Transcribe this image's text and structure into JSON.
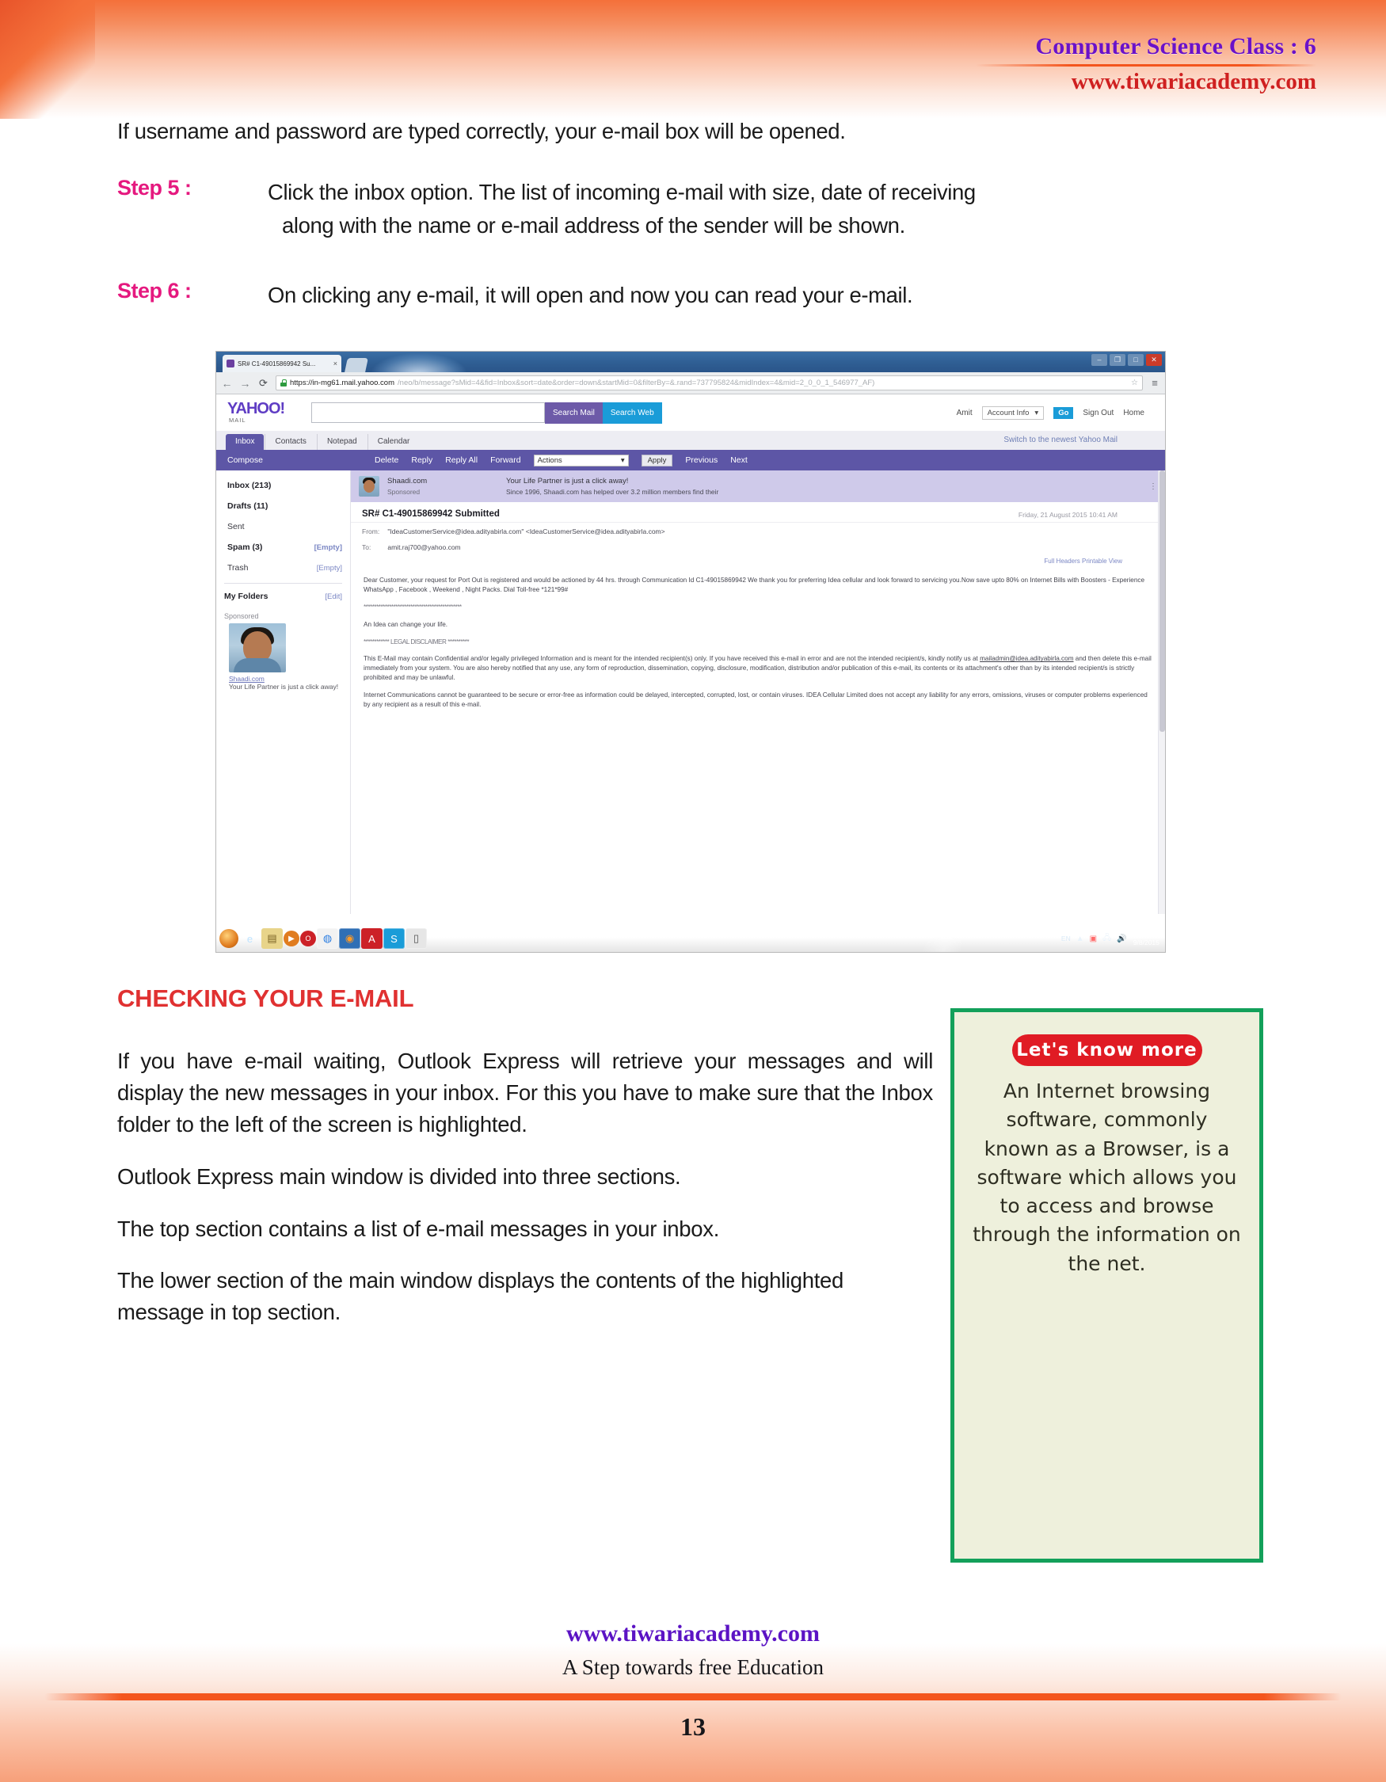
{
  "header": {
    "title": "Computer Science Class : 6",
    "site": "www.tiwariacademy.com"
  },
  "intro": "If username and password are typed correctly, your e-mail box will be opened.",
  "steps": [
    {
      "label": "Step 5 :",
      "line1": "Click the inbox option. The list of incoming e-mail with size, date of receiving",
      "line2": "along with the name or e-mail address of the sender will be shown."
    },
    {
      "label": "Step 6 :",
      "line1": "On clicking any e-mail, it will open and now you can read your e-mail.",
      "line2": ""
    }
  ],
  "screenshot": {
    "browser": {
      "tab_title": "SR# C1-49015869942 Su...",
      "tab_close": "×",
      "win_min": "–",
      "win_restore": "❐",
      "win_max": "□",
      "win_close": "✕",
      "back": "←",
      "forward": "→",
      "reload": "⟳",
      "url_strong": "https://in-mg61.mail.yahoo.com",
      "url_rest": "/neo/b/message?sMid=4&fid=Inbox&sort=date&order=down&startMid=0&filterBy=&.rand=737795824&midIndex=4&mid=2_0_0_1_546977_AF)",
      "star": "☆",
      "menu": "≡"
    },
    "yahoo": {
      "logo_main": "YAHOO!",
      "logo_sub": "MAIL",
      "search_placeholder": "",
      "search_mail": "Search Mail",
      "search_web": "Search Web",
      "user": "Amit",
      "account_info": "Account Info",
      "account_caret": "▾",
      "go": "Go",
      "sign_out": "Sign Out",
      "home": "Home",
      "switch_link": "Switch to the newest Yahoo Mail",
      "tabs": [
        "Inbox",
        "Contacts",
        "Notepad",
        "Calendar"
      ],
      "toolbar": {
        "compose": "Compose",
        "delete": "Delete",
        "reply": "Reply",
        "reply_all": "Reply All",
        "forward": "Forward",
        "actions": "Actions",
        "actions_caret": "▾",
        "apply": "Apply",
        "previous": "Previous",
        "next": "Next"
      },
      "folders": [
        {
          "name": "Inbox (213)",
          "action": "",
          "bold": true
        },
        {
          "name": "Drafts (11)",
          "action": "",
          "bold": true
        },
        {
          "name": "Sent",
          "action": "",
          "bold": false
        },
        {
          "name": "Spam (3)",
          "action": "[Empty]",
          "bold": true
        },
        {
          "name": "Trash",
          "action": "[Empty]",
          "bold": false
        }
      ],
      "my_folders": "My Folders",
      "my_folders_caret": "▾",
      "my_folders_edit": "[Edit]",
      "sponsored_label": "Sponsored",
      "sponsored_caret": "×",
      "sponsored_link": "Shaadi.com",
      "sponsored_text": "Your Life Partner is just a click away!",
      "ad": {
        "name": "Shaadi.com",
        "sub": "Sponsored",
        "headline": "Your Life Partner is just a click away!",
        "body": "Since 1996, Shaadi.com has helped over 3.2 million members find their",
        "menu": "⋮"
      },
      "message": {
        "subject": "SR# C1-49015869942 Submitted",
        "date": "Friday, 21 August 2015 10:41 AM",
        "date_icons": "⚑",
        "from_label": "From:",
        "from_value": "\"IdeaCustomerService@idea.adityabirla.com\" <IdeaCustomerService@idea.adityabirla.com>",
        "to_label": "To:",
        "to_value": "amit.raj700@yahoo.com",
        "full_headers": "Full Headers Printable View",
        "body_p1": "Dear Customer, your request for Port Out is registered and would be actioned by 44 hrs. through Communication Id C1-49015869942 We thank you for preferring Idea cellular and look forward to servicing you.Now save upto 80% on Internet Bills with Boosters - Experience WhatsApp , Facebook , Weekend , Night Packs. Dial Toll-free *121*99#",
        "body_rule": "**********************************************",
        "body_tagline": "An Idea can change your life.",
        "disclaimer_title": "************ LEGAL DISCLAIMER **********",
        "disclaimer_p1_a": "This E-Mail may contain Confidential and/or legally privileged Information and is meant for the intended recipient(s) only. If you have received this e-mail in error and are not the intended recipient/s, kindly notify us at ",
        "disclaimer_link": "mailadmin@idea.adityabirla.com",
        "disclaimer_p1_b": " and then delete this e-mail immediately from your system. You are also hereby notified that any use, any form of reproduction, dissemination, copying, disclosure, modification, distribution and/or publication of this e-mail, its contents or its attachment's other than by its intended recipient/s is strictly prohibited and may be unlawful.",
        "disclaimer_p2": "Internet Communications cannot be guaranteed to be secure or error-free as information could be delayed, intercepted, corrupted, lost, or contain viruses. IDEA Cellular Limited does not accept any liability for any errors, omissions, viruses or computer problems experienced by any recipient as a result of this e-mail."
      }
    },
    "taskbar": {
      "icons": [
        "start-orb-icon",
        "internet-explorer-icon",
        "explorer-folder-icon",
        "media-player-icon",
        "opera-icon",
        "chrome-icon",
        "firefox-icon",
        "adobe-reader-icon",
        "skype-icon",
        "app-icon"
      ],
      "lang": "EN",
      "show_hidden": "▲",
      "time": "11:04 AM",
      "date": "9/8/2015"
    }
  },
  "section": {
    "heading": "CHECKING YOUR E-MAIL",
    "paragraphs": [
      "If you have e-mail waiting, Outlook Express will retrieve your messages and will display the new messages in your inbox. For this you have to make sure that the Inbox folder to the left of the screen is highlighted.",
      "Outlook Express main window is divided into three sections.",
      "The top section contains a list of e-mail messages in your inbox.",
      "The lower section of the main window displays the contents of the highlighted message in top section."
    ]
  },
  "know_box": {
    "pill": "Let's know more",
    "text": "An Internet browsing software, commonly known as a Browser, is a software which allows you to access and browse through the information on the net."
  },
  "footer": {
    "site": "www.tiwariacademy.com",
    "tagline": "A Step towards free Education",
    "page": "13"
  },
  "colors": {
    "header_title": "#6a12c9",
    "header_site": "#cf2020",
    "step_label": "#e5197f",
    "section_heading": "#e03131",
    "know_border": "#13a05a",
    "know_bg": "#eef0dc",
    "pill_bg": "#e01b24",
    "footer_site": "#5b13c4",
    "accent_orange": "#f4551d"
  }
}
